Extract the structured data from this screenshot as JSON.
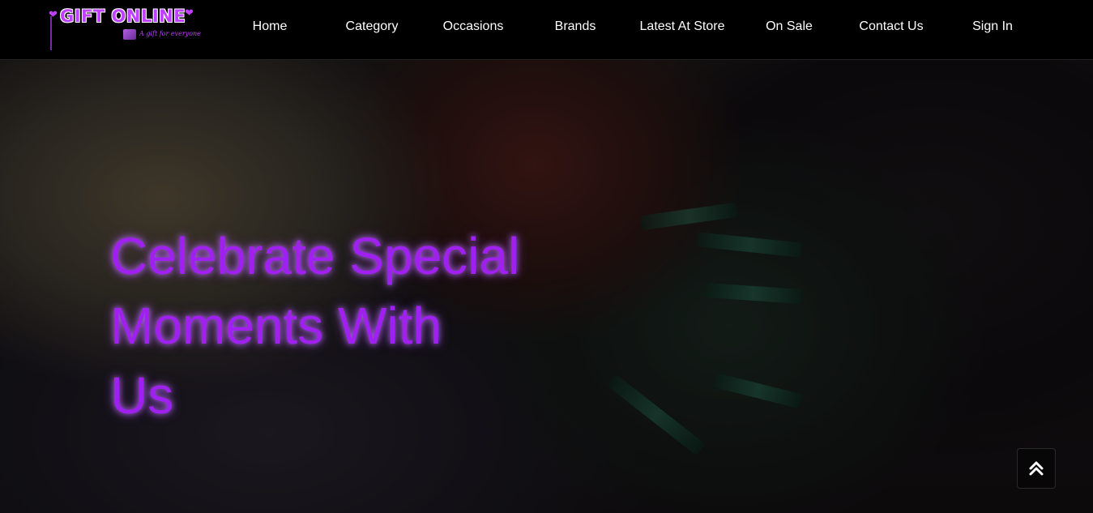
{
  "logo": {
    "title": "GIFT ONLINE",
    "tagline": "A gift for everyone",
    "icon": "heart-icon"
  },
  "nav": {
    "items": [
      {
        "label": "Home"
      },
      {
        "label": "Category"
      },
      {
        "label": "Occasions"
      },
      {
        "label": "Brands"
      },
      {
        "label": "Latest At Store"
      },
      {
        "label": "On Sale"
      },
      {
        "label": "Contact Us"
      },
      {
        "label": "Sign In"
      }
    ]
  },
  "hero": {
    "heading_line1": "Celebrate Special",
    "heading_line2": "Moments With",
    "heading_line3": "Us"
  },
  "scroll_top": {
    "icon": "double-chevron-up-icon"
  },
  "colors": {
    "accent": "#a020f0",
    "navbar_bg": "#000000",
    "nav_text": "#ffffff"
  }
}
